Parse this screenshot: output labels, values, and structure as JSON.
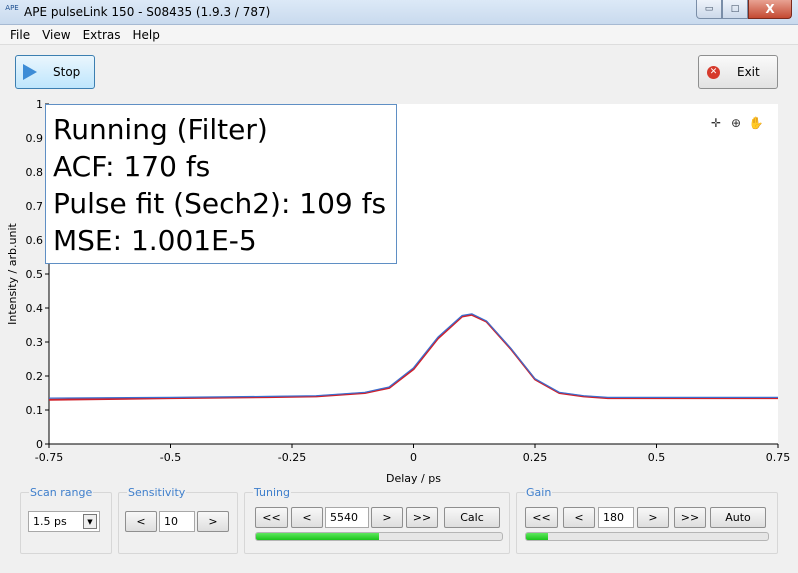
{
  "window": {
    "title": "APE pulseLink 150 - S08435 (1.9.3 / 787)",
    "logo_text": "APE",
    "minimize": "▭",
    "maximize": "□",
    "close": "X"
  },
  "menu": [
    "File",
    "View",
    "Extras",
    "Help"
  ],
  "toolbar": {
    "stop_label": "Stop",
    "exit_label": "Exit"
  },
  "status": {
    "line1": "Running (Filter)",
    "line2": "ACF: 170 fs",
    "line3": "Pulse fit (Sech2): 109 fs",
    "line4": "MSE: 1.001E-5"
  },
  "plot_tools": [
    "crosshair-icon",
    "zoom-icon",
    "pan-hand-icon"
  ],
  "chart_data": {
    "type": "line",
    "xlabel": "Delay / ps",
    "ylabel": "Intensity / arb.unit",
    "xlim": [
      -0.75,
      0.75
    ],
    "ylim": [
      0,
      1
    ],
    "xticks": [
      "-0.75",
      "-0.5",
      "-0.25",
      "0",
      "0.25",
      "0.5",
      "0.75"
    ],
    "yticks": [
      "0",
      "0.1",
      "0.2",
      "0.3",
      "0.4",
      "0.5",
      "0.6",
      "0.7",
      "0.8",
      "0.9",
      "1"
    ],
    "grid": false,
    "series": [
      {
        "color": "#d0202a",
        "x": [
          -0.75,
          -0.5,
          -0.3,
          -0.2,
          -0.1,
          -0.05,
          0.0,
          0.05,
          0.1,
          0.12,
          0.15,
          0.2,
          0.25,
          0.3,
          0.35,
          0.4,
          0.5,
          0.75
        ],
        "y": [
          0.13,
          0.135,
          0.138,
          0.14,
          0.15,
          0.165,
          0.22,
          0.31,
          0.375,
          0.38,
          0.36,
          0.28,
          0.19,
          0.15,
          0.14,
          0.135,
          0.135,
          0.135
        ]
      },
      {
        "color": "#3b6fd0",
        "x": [
          -0.75,
          -0.5,
          -0.3,
          -0.2,
          -0.1,
          -0.05,
          0.0,
          0.05,
          0.1,
          0.12,
          0.15,
          0.2,
          0.25,
          0.3,
          0.35,
          0.4,
          0.5,
          0.75
        ],
        "y": [
          0.135,
          0.137,
          0.14,
          0.142,
          0.152,
          0.168,
          0.224,
          0.314,
          0.378,
          0.383,
          0.362,
          0.282,
          0.192,
          0.152,
          0.142,
          0.137,
          0.137,
          0.137
        ]
      }
    ]
  },
  "controls": {
    "scan_range": {
      "title": "Scan range",
      "value": "1.5 ps"
    },
    "sensitivity": {
      "title": "Sensitivity",
      "dec": "<",
      "value": "10",
      "inc": ">"
    },
    "tuning": {
      "title": "Tuning",
      "fast_dec": "<<",
      "dec": "<",
      "value": "5540",
      "inc": ">",
      "fast_inc": ">>",
      "calc": "Calc",
      "progress": 0.5
    },
    "gain": {
      "title": "Gain",
      "fast_dec": "<<",
      "dec": "<",
      "value": "180",
      "inc": ">",
      "fast_inc": ">>",
      "auto": "Auto",
      "progress": 0.09
    }
  }
}
